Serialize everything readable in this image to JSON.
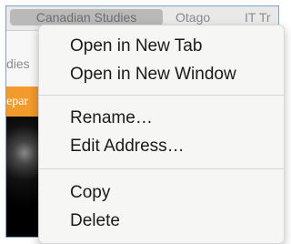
{
  "bookmarks": [
    {
      "label": "Canadian Studies"
    },
    {
      "label": "Otago"
    },
    {
      "label": "IT Tr"
    }
  ],
  "page": {
    "partial_text": "dies",
    "orange_text": "epar"
  },
  "context_menu": {
    "items": [
      {
        "label": "Open in New Tab"
      },
      {
        "label": "Open in New Window"
      },
      {
        "label": "Rename…"
      },
      {
        "label": "Edit Address…"
      },
      {
        "label": "Copy"
      },
      {
        "label": "Delete"
      }
    ]
  }
}
